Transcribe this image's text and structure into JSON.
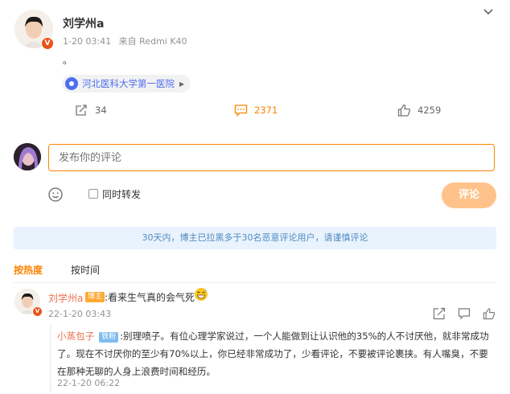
{
  "post": {
    "author": "刘学州a",
    "timestamp": "1-20 03:41",
    "source": "来自 Redmi K40",
    "body": "。",
    "location": "河北医科大学第一医院",
    "reposts": "34",
    "comments": "2371",
    "likes": "4259"
  },
  "compose": {
    "placeholder": "发布你的评论",
    "repost_label": "同时转发",
    "submit_label": "评论"
  },
  "notice": "30天内，博主已拉黑多于30名恶意评论用户，请谨慎评论",
  "sort": {
    "hot": "按热度",
    "time": "按时间"
  },
  "comment": {
    "author": "刘学州a",
    "badge": "博主",
    "text": ":看来生气真的会气死",
    "time": "22-1-20 03:43"
  },
  "reply": {
    "author": "小蒸包子",
    "badge": "铁粉",
    "text": ":别理喷子。有位心理学家说过，一个人能做到让认识他的35%的人不讨厌他，就非常成功了。现在不讨厌你的至少有70%以上，你已经非常成功了，少看评论，不要被评论裹挟。有人嘴臭，不要在那种无聊的人身上浪费时间和经历。",
    "time": "22-1-20 06:22"
  },
  "colors": {
    "accent": "#ff8200",
    "link": "#eb7350",
    "notice_bg": "#e9f3fd"
  },
  "icons": [
    "chevron-down-icon",
    "location-pin-icon",
    "repost-icon",
    "comment-icon",
    "like-icon",
    "emoji-icon"
  ]
}
